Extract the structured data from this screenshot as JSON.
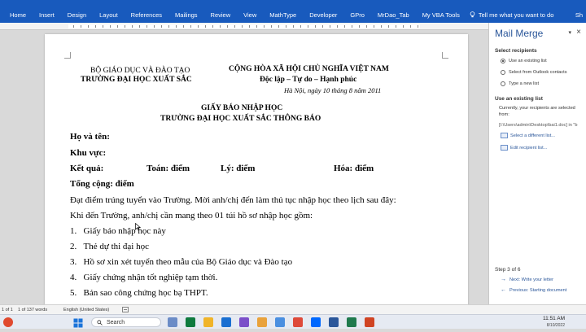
{
  "ribbon": {
    "tabs": [
      "Home",
      "Insert",
      "Design",
      "Layout",
      "References",
      "Mailings",
      "Review",
      "View",
      "MathType",
      "Developer",
      "GPro",
      "MrDao_Tab",
      "My VBA Tools"
    ],
    "tell_me": "Tell me what you want to do",
    "share": "Sh"
  },
  "document": {
    "org_left_1": "BỘ GIÁO DỤC VÀ ĐÀO TẠO",
    "org_left_2": "TRƯỜNG ĐẠI HỌC XUẤT SẮC",
    "org_right_1": "CỘNG HÒA XÃ HỘI CHỦ NGHĨA VIỆT NAM",
    "org_right_2": "Độc lập – Tự do – Hạnh phúc",
    "place_date": "Hà Nội, ngày 10 tháng 8 năm 2011",
    "title_1": "GIẤY BÁO NHẬP HỌC",
    "title_2": "TRƯỜNG ĐẠI HỌC XUẤT SẮC THÔNG BÁO",
    "name_label": "Họ và tên:",
    "area_label": "Khu vực:",
    "result_label": "Kết quả:",
    "math": "Toán:  điểm",
    "physics": "Lý:  điểm",
    "chem": "Hóa:  điểm",
    "total": "Tổng cộng: điểm",
    "para_1": "Đạt điểm trúng tuyển vào Trường. Mời anh/chị đến làm thủ tục nhập học theo lịch sau đây:",
    "para_2": "Khi đến Trường, anh/chị cần mang theo 01 túi hồ sơ nhập học gồm:",
    "list": [
      {
        "num": "1.",
        "text": "Giấy báo nhập học này"
      },
      {
        "num": "2.",
        "text": "Thẻ dự thi đại học"
      },
      {
        "num": "3.",
        "text": "Hồ sơ xin xét tuyển theo mẫu của Bộ Giáo dục và Đào tạo"
      },
      {
        "num": "4.",
        "text": "Giấy chứng nhận tốt nghiệp tạm thời."
      },
      {
        "num": "5.",
        "text": "Bản sao công chứng học bạ THPT."
      }
    ]
  },
  "mail_merge": {
    "title": "Mail Merge",
    "close": "×",
    "dropdown": "▾",
    "select_recipients": "Select recipients",
    "options": [
      "Use an existing list",
      "Select from Outlook contacts",
      "Type a new list"
    ],
    "use_existing_head": "Use an existing list",
    "current_text_1": "Currently, your recipients are selected",
    "current_text_2": "from:",
    "path": "[I:\\Users\\admin\\Desktop\\bai1.doc] in \"b",
    "select_different": "Select a different list...",
    "edit_list": "Edit recipient list...",
    "step": "Step 3 of 6",
    "next": "Next: Write your letter",
    "previous": "Previous: Starting document"
  },
  "status": {
    "page": "1 of 1",
    "words": "1 of 137 words",
    "language": "English (United States)"
  },
  "taskbar": {
    "search": "Search",
    "time": "11:51 AM",
    "date": "8/10/2022"
  },
  "colors": {
    "ribbon": "#185abd",
    "accent": "#2b579a"
  }
}
